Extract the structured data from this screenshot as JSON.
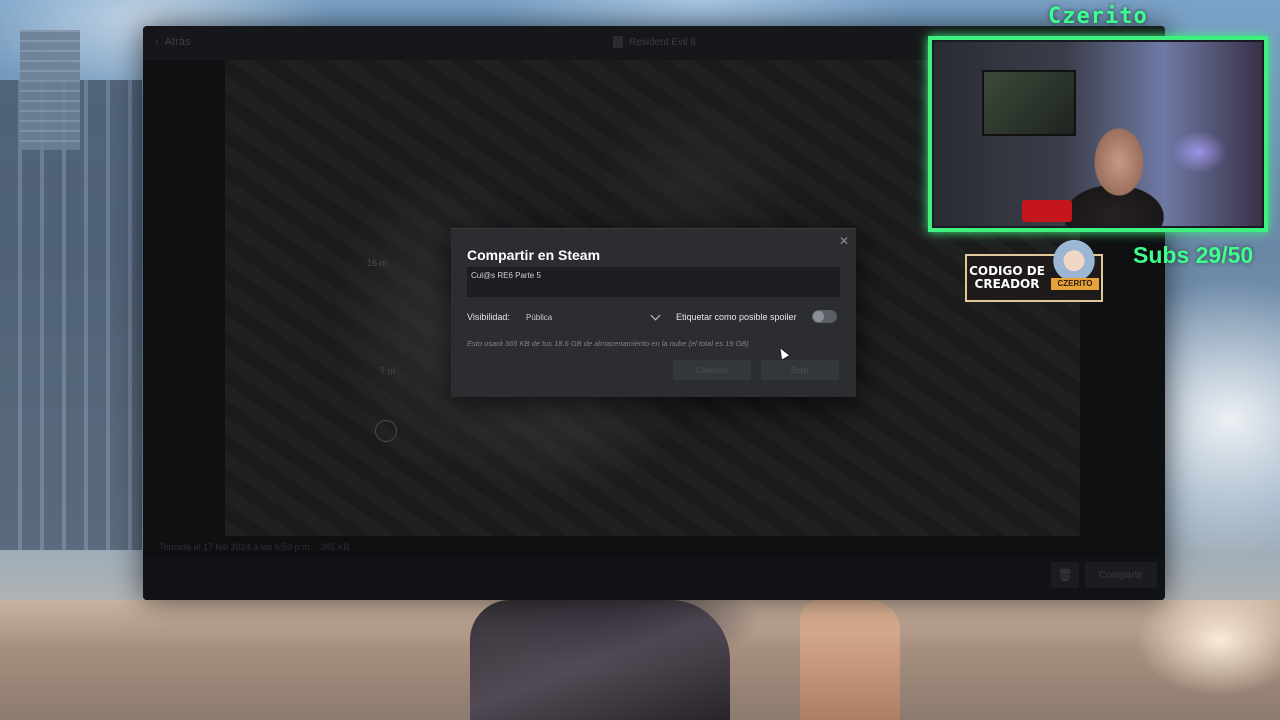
{
  "steam_window": {
    "back_label": "Atrás",
    "game_title": "Resident Evil 6",
    "screenshot_info": "Tomada el 17 feb 2024 a las 6:59 p.m. · 365 KB",
    "hud": {
      "marker1": "16 m",
      "marker2": "7 m"
    },
    "share_button": "Compartir",
    "trash_icon": "trash-icon"
  },
  "dialog": {
    "title": "Compartir en Steam",
    "close_icon": "close-icon",
    "title_field": {
      "value": "Cul@s RE6 Parte 5"
    },
    "visibility": {
      "label": "Visibilidad:",
      "selected": "Pública"
    },
    "spoiler": {
      "label": "Etiquetar como posible spoiler",
      "enabled": false
    },
    "storage_note": "Esto usará 365 KB de tus 18.6 GB de almacenamiento en la nube (el total es 19 GB)",
    "buttons": {
      "cancel": "Cancelar",
      "upload": "Subir"
    }
  },
  "overlay": {
    "streamer_name": "Czerito",
    "creator_code": "CODIGO DE CREADOR",
    "creator_tag": "CZERITO",
    "subs": "Subs 29/50",
    "accent_color": "#3dff8e"
  }
}
